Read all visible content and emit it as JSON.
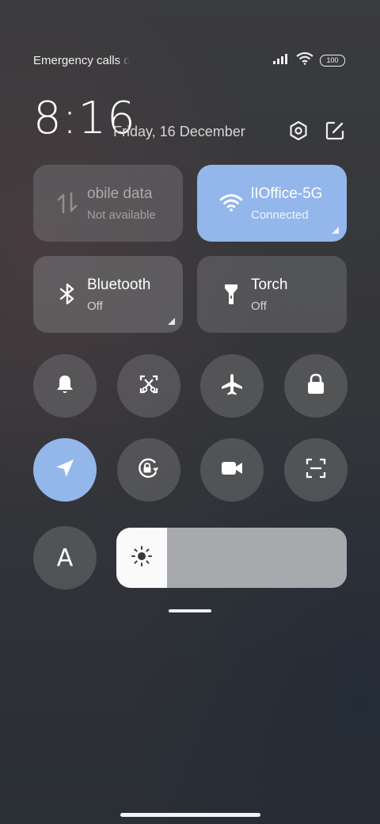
{
  "status_bar": {
    "carrier_text": "Emergency calls o",
    "battery_level": "100"
  },
  "header": {
    "time": "8:16",
    "date": "Friday, 16 December"
  },
  "toggles": {
    "mobile_data": {
      "title": "obile data",
      "subtitle": "Not available"
    },
    "wifi": {
      "title": "lIOffice-5G",
      "subtitle": "Connected"
    },
    "bluetooth": {
      "title": "Bluetooth",
      "subtitle": "Off"
    },
    "torch": {
      "title": "Torch",
      "subtitle": "Off"
    }
  },
  "colors": {
    "active_accent": "#93b6eb",
    "tile_gray": "#6e6e70"
  },
  "icons": [
    "signal-icon",
    "wifi-icon",
    "battery-icon",
    "settings-icon",
    "edit-icon",
    "mobile-data-icon",
    "bluetooth-icon",
    "torch-icon",
    "bell-icon",
    "screenshot-icon",
    "airplane-icon",
    "lock-icon",
    "location-icon",
    "rotation-lock-icon",
    "video-icon",
    "scan-icon",
    "font-a-icon",
    "brightness-icon"
  ],
  "round_toggles": {
    "row1": [
      "bell",
      "screenshot",
      "airplane",
      "lock"
    ],
    "row2": [
      "location",
      "rotation-lock",
      "video",
      "scan"
    ],
    "font_label": "A"
  },
  "brightness": {
    "level": 0.22
  }
}
